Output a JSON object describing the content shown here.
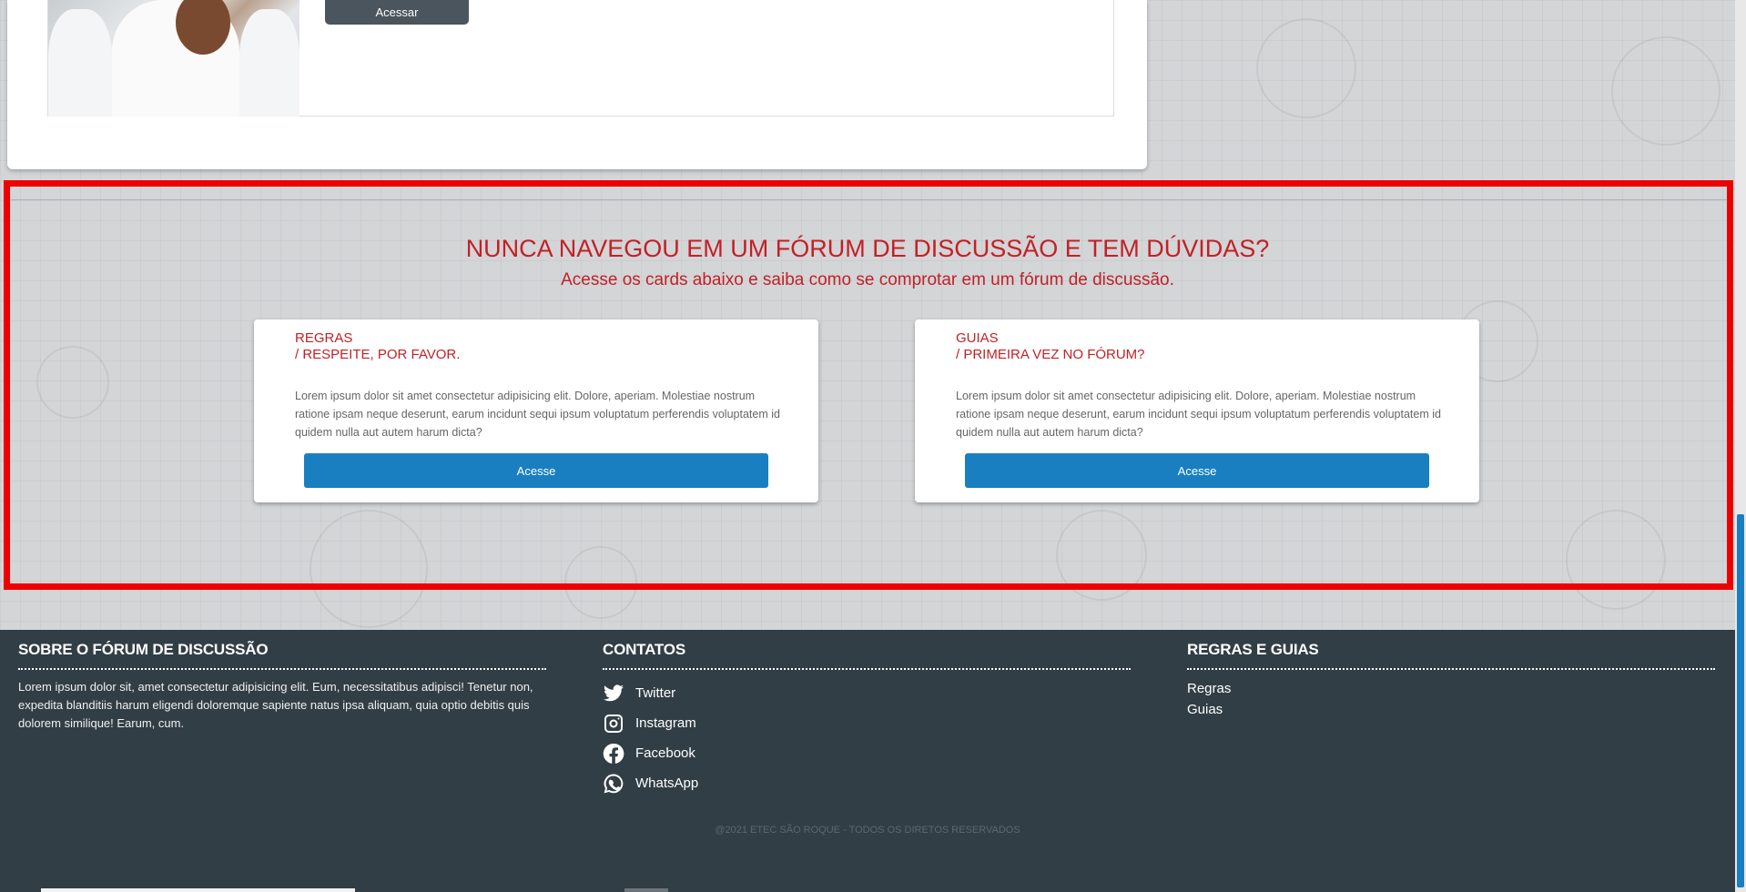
{
  "top_card": {
    "button_label": "Acessar"
  },
  "intro": {
    "title": "NUNCA NAVEGOU EM UM FÓRUM DE DISCUSSÃO E TEM DÚVIDAS?",
    "subtitle": "Acesse os cards abaixo e saiba como se comprotar em um fórum de discussão."
  },
  "cards": [
    {
      "title_line1": "REGRAS",
      "title_line2": "/ RESPEITE, POR FAVOR.",
      "text": "Lorem ipsum dolor sit amet consectetur adipisicing elit. Dolore, aperiam. Molestiae nostrum ratione ipsam neque deserunt, earum incidunt sequi ipsum voluptatum perferendis voluptatem id quidem nulla aut autem harum dicta?",
      "button_label": "Acesse"
    },
    {
      "title_line1": "GUIAS",
      "title_line2": "/ PRIMEIRA VEZ NO FÓRUM?",
      "text": "Lorem ipsum dolor sit amet consectetur adipisicing elit. Dolore, aperiam. Molestiae nostrum ratione ipsam neque deserunt, earum incidunt sequi ipsum voluptatum perferendis voluptatem id quidem nulla aut autem harum dicta?",
      "button_label": "Acesse"
    }
  ],
  "footer": {
    "about": {
      "heading": "SOBRE O FÓRUM DE DISCUSSÃO",
      "text": "Lorem ipsum dolor sit, amet consectetur adipisicing elit. Eum, necessitatibus adipisci! Tenetur non, expedita blanditiis harum eligendi doloremque sapiente natus ipsa aliquam, quia optio debitis quis dolorem similique! Earum, cum."
    },
    "contacts": {
      "heading": "CONTATOS",
      "items": [
        {
          "label": "Twitter",
          "icon": "twitter-icon"
        },
        {
          "label": "Instagram",
          "icon": "instagram-icon"
        },
        {
          "label": "Facebook",
          "icon": "facebook-icon"
        },
        {
          "label": "WhatsApp",
          "icon": "whatsapp-icon"
        }
      ]
    },
    "rules": {
      "heading": "REGRAS E GUIAS",
      "links": [
        "Regras",
        "Guias"
      ]
    },
    "copyright": "@2021 ETEC SÃO ROQUE - TODOS OS DIRETOS RESERVADOS"
  },
  "colors": {
    "accent_red": "#c32026",
    "button_blue": "#1a7fc1",
    "footer_bg": "#323e46",
    "highlight_frame": "#ee0000"
  }
}
